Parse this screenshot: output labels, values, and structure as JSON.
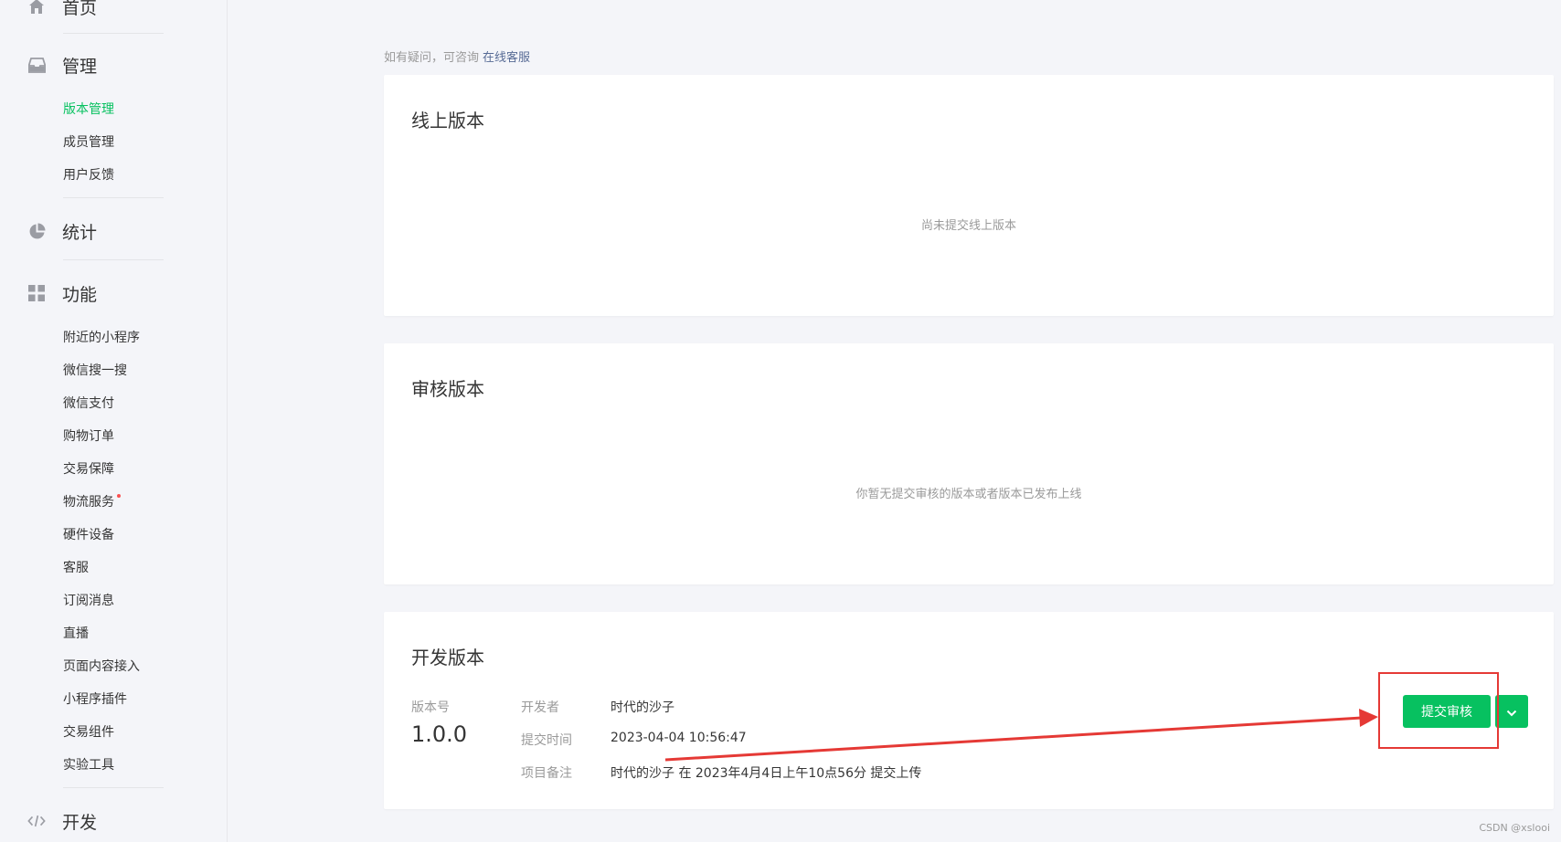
{
  "sidebar": {
    "home_label": "首页",
    "manage": {
      "label": "管理",
      "items": [
        "版本管理",
        "成员管理",
        "用户反馈"
      ]
    },
    "stats": {
      "label": "统计"
    },
    "features": {
      "label": "功能",
      "items": [
        "附近的小程序",
        "微信搜一搜",
        "微信支付",
        "购物订单",
        "交易保障",
        "物流服务",
        "硬件设备",
        "客服",
        "订阅消息",
        "直播",
        "页面内容接入",
        "小程序插件",
        "交易组件",
        "实验工具"
      ]
    },
    "develop": {
      "label": "开发"
    }
  },
  "page": {
    "hint_text": "如有疑问，可咨询",
    "hint_link": "在线客服"
  },
  "online_card": {
    "title": "线上版本",
    "empty": "尚未提交线上版本"
  },
  "review_card": {
    "title": "审核版本",
    "empty": "你暂无提交审核的版本或者版本已发布上线"
  },
  "dev_card": {
    "title": "开发版本",
    "version_label": "版本号",
    "version": "1.0.0",
    "developer_label": "开发者",
    "developer": "时代的沙子",
    "submit_time_label": "提交时间",
    "submit_time": "2023-04-04 10:56:47",
    "remark_label": "项目备注",
    "remark": "时代的沙子 在 2023年4月4日上午10点56分 提交上传",
    "submit_button": "提交审核"
  },
  "watermark": "CSDN @xslooi",
  "colors": {
    "accent": "#07c160",
    "link": "#576b95",
    "annotation": "#e53935"
  }
}
